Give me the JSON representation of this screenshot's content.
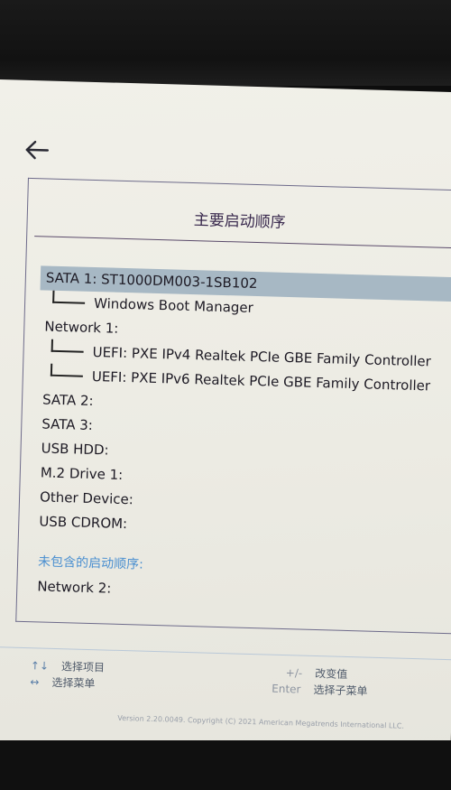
{
  "header": {
    "back_icon": "arrow-left-icon",
    "title": "主要启动顺序"
  },
  "boot_list": {
    "selected": "SATA 1: ST1000DM003-1SB102",
    "items": [
      {
        "label": "SATA 1: ST1000DM003-1SB102",
        "level": 0
      },
      {
        "label": "Windows Boot Manager",
        "level": 1
      },
      {
        "label": "Network 1:",
        "level": 0
      },
      {
        "label": "UEFI: PXE IPv4 Realtek PCIe GBE Family Controller",
        "level": 1
      },
      {
        "label": "UEFI: PXE IPv6 Realtek PCIe GBE Family Controller",
        "level": 1
      },
      {
        "label": "SATA 2:",
        "level": 0
      },
      {
        "label": "SATA 3:",
        "level": 0
      },
      {
        "label": "USB HDD:",
        "level": 0
      },
      {
        "label": "M.2 Drive 1:",
        "level": 0
      },
      {
        "label": "Other Device:",
        "level": 0
      },
      {
        "label": "USB CDROM:",
        "level": 0
      }
    ]
  },
  "excluded": {
    "label": "未包含的启动顺序:",
    "items": [
      {
        "label": "Network 2:"
      }
    ]
  },
  "footer": {
    "hints": [
      {
        "key": "↑↓",
        "action": "选择项目"
      },
      {
        "key": "↔",
        "action": "选择菜单"
      },
      {
        "key": "+/-",
        "action": "改变值"
      },
      {
        "key": "Enter",
        "action": "选择子菜单"
      }
    ],
    "version": "Version 2.20.0049. Copyright (C) 2021 American Megatrends International LLC."
  },
  "colors": {
    "selection": "#a7b8c4",
    "section_label": "#4a8fd0",
    "title": "#3a2a4e",
    "background": "#efeee7"
  }
}
